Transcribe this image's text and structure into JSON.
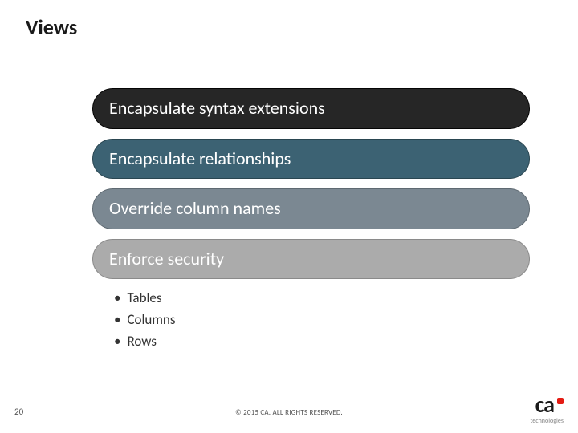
{
  "title": "Views",
  "pills": [
    {
      "label": "Encapsulate syntax extensions"
    },
    {
      "label": "Encapsulate relationships"
    },
    {
      "label": "Override column names"
    },
    {
      "label": "Enforce security"
    }
  ],
  "bullets": [
    "Tables",
    "Columns",
    "Rows"
  ],
  "page_number": "20",
  "copyright": "© 2015 CA. ALL RIGHTS RESERVED.",
  "brand": {
    "name": "ca",
    "sub": "technologies"
  }
}
